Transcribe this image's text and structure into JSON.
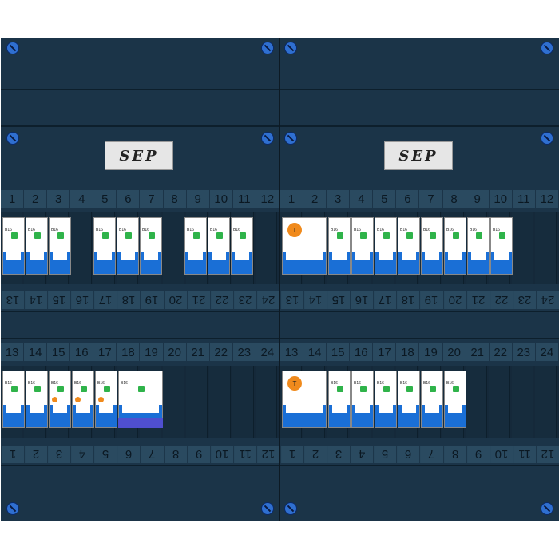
{
  "brand": {
    "logo_text": "SEP"
  },
  "top_numbers": [
    "1",
    "2",
    "3",
    "4",
    "5",
    "6",
    "7",
    "8",
    "9",
    "10",
    "11",
    "12"
  ],
  "upper_mid_numbers": [
    "13",
    "14",
    "15",
    "16",
    "17",
    "18",
    "19",
    "20",
    "21",
    "22",
    "23",
    "24"
  ],
  "lower_top_numbers": [
    "13",
    "14",
    "15",
    "16",
    "17",
    "18",
    "19",
    "20",
    "21",
    "22",
    "23",
    "24"
  ],
  "bottom_numbers": [
    "1",
    "2",
    "3",
    "4",
    "5",
    "6",
    "7",
    "8",
    "9",
    "10",
    "11",
    "12"
  ],
  "left_rcd_label": "T",
  "right_rcd_label": "T",
  "breaker_label": "B16",
  "colors": {
    "panel": "#1b3448",
    "toggle_blue": "#1a6fd6",
    "led_green": "#2fb34a",
    "rcd_orange": "#f08a1c",
    "screw_blue": "#2f6fd0"
  }
}
